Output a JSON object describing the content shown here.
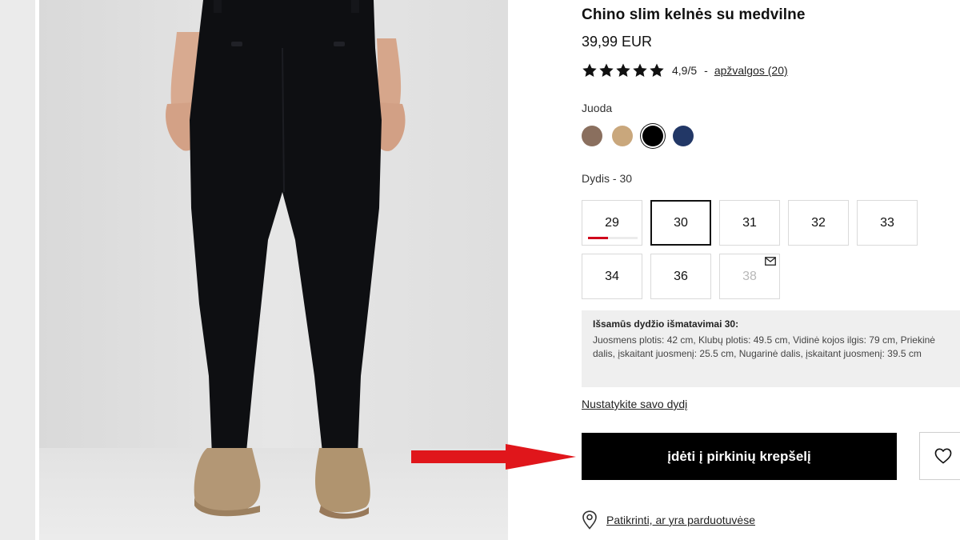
{
  "product": {
    "title": "Chino slim kelnės su medvilne",
    "price": "39,99 EUR",
    "rating": {
      "stars": 5,
      "score_text": "4,9/5",
      "separator": "-",
      "reviews_link": "apžvalgos (20)"
    }
  },
  "color": {
    "selected_label": "Juoda",
    "swatches": [
      {
        "name": "brown",
        "hex": "#8a6f5e",
        "selected": false
      },
      {
        "name": "beige",
        "hex": "#c9a77c",
        "selected": false
      },
      {
        "name": "black",
        "hex": "#000000",
        "selected": true
      },
      {
        "name": "navy",
        "hex": "#223766",
        "selected": false
      }
    ]
  },
  "size": {
    "label": "Dydis -  30",
    "options": [
      {
        "value": "29",
        "state": "low_stock",
        "stock_level": 0.4
      },
      {
        "value": "30",
        "state": "selected"
      },
      {
        "value": "31",
        "state": "available"
      },
      {
        "value": "32",
        "state": "available"
      },
      {
        "value": "33",
        "state": "available"
      },
      {
        "value": "34",
        "state": "available"
      },
      {
        "value": "36",
        "state": "available"
      },
      {
        "value": "38",
        "state": "unavailable_notify"
      }
    ]
  },
  "measurements": {
    "title": "Išsamūs dydžio išmatavimai 30:",
    "text": "Juosmens plotis: 42 cm, Klubų plotis: 49.5 cm, Vidinė kojos ilgis: 79 cm, Priekinė dalis, įskaitant juosmenį: 25.5 cm, Nugarinė dalis, įskaitant juosmenį: 39.5 cm"
  },
  "size_finder_link": "Nustatykite savo dydį",
  "add_to_cart_label": "įdėti į pirkinių krepšelį",
  "store_check_link": "Patikrinti, ar yra parduotuvėse",
  "icons": {
    "wishlist": "heart-icon",
    "store": "location-pin-icon",
    "notify": "mail-icon",
    "rating": "star-icon"
  },
  "colors": {
    "accent": "#000000",
    "stock_warning": "#d0021b",
    "annotation_arrow": "#e0161b",
    "info_box_bg": "#efefef"
  }
}
